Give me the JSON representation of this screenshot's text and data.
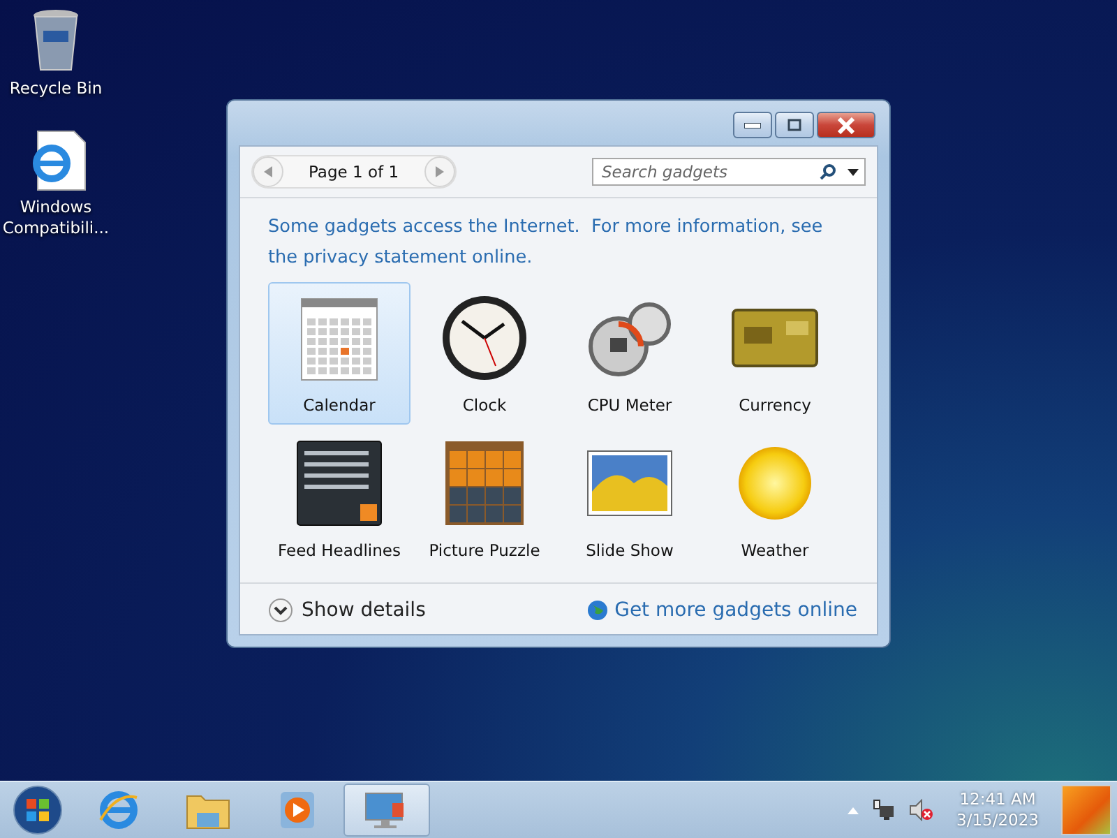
{
  "desktop_icons": [
    {
      "label": "Recycle Bin",
      "kind": "recycle"
    },
    {
      "label": "Windows Compatibili...",
      "kind": "ie-document"
    }
  ],
  "window": {
    "page_label": "Page 1 of 1",
    "search": {
      "placeholder": "Search gadgets"
    },
    "notice": "Some gadgets access the Internet.  For more information, see the privacy statement online.",
    "gadgets": [
      {
        "name": "Calendar",
        "kind": "calendar",
        "selected": true
      },
      {
        "name": "Clock",
        "kind": "clock",
        "selected": false
      },
      {
        "name": "CPU Meter",
        "kind": "meter",
        "selected": false
      },
      {
        "name": "Currency",
        "kind": "currency",
        "selected": false
      },
      {
        "name": "Feed Headlines",
        "kind": "feed",
        "selected": false
      },
      {
        "name": "Picture Puzzle",
        "kind": "puzzle",
        "selected": false
      },
      {
        "name": "Slide Show",
        "kind": "slideshow",
        "selected": false
      },
      {
        "name": "Weather",
        "kind": "weather",
        "selected": false
      }
    ],
    "show_details": "Show details",
    "more_link": "Get more gadgets online"
  },
  "taskbar": {
    "apps": [
      {
        "kind": "browser",
        "selected": false
      },
      {
        "kind": "folder",
        "selected": false
      },
      {
        "kind": "player",
        "selected": false
      },
      {
        "kind": "gadgets",
        "selected": true
      }
    ],
    "time": "12:41 AM",
    "date": "3/15/2023"
  }
}
